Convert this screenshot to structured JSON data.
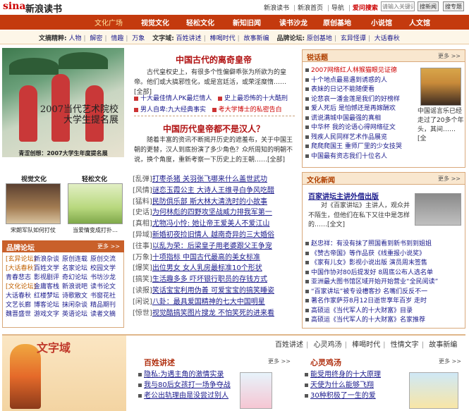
{
  "header": {
    "logo": "sina",
    "site_name": "新浪读书",
    "links": [
      "新浪读书",
      "新浪首页",
      "导航",
      "爱问搜索"
    ],
    "search_placeholder": "请输入关键词",
    "search_btn": "搜新闻",
    "search_btn2": "搜专题"
  },
  "nav": {
    "items": [
      "文化广场",
      "视觉文化",
      "轻松文化",
      "新知旧闻",
      "读书沙龙",
      "原创基地",
      "小说馆",
      "人文馆"
    ]
  },
  "subnav": {
    "groups": [
      {
        "label": "文摘精粹:",
        "links": [
          "人物",
          "解密",
          "情趣",
          "万象"
        ]
      },
      {
        "label": "文字域:",
        "links": [
          "百姓讲述",
          "棒喝时代",
          "故事新编"
        ]
      },
      {
        "label": "品牌论坛:",
        "links": [
          "原创基地",
          "玄异怪谭",
          "大话春秋"
        ]
      }
    ]
  },
  "promo": {
    "text_line1": "2007当代艺术院校",
    "text_line2": "大学生提名展",
    "caption": "青涩创想：2007大学生年度提名展"
  },
  "thumbs": [
    {
      "title": "视觉文化",
      "caption": "宋朗军队如何打仗"
    },
    {
      "title": "轻松文化",
      "caption": "当爱情变成打扑…"
    }
  ],
  "forum": {
    "title": "品牌论坛",
    "more": "更多 >>",
    "rows": [
      [
        "[玄异论坛]",
        "新浪杂谈",
        "原创连载",
        "原创交流"
      ],
      [
        "[大话春秋]",
        "百姓文学",
        "名家论坛",
        "校园文学"
      ],
      [
        "青春悲志",
        "影视剧评",
        "奇幻论坛",
        "书坊沙龙"
      ],
      [
        "[文化论坛]",
        "金庸客栈",
        "新浪说吧",
        "读书论文"
      ],
      [
        "大话春秋",
        "红楼梦坛",
        "诗歌散文",
        "书窗花社"
      ],
      [
        "文艺长廊",
        "博客论坛",
        "抹闲杂谈",
        "精品期刊"
      ],
      [
        "魏晋盛世",
        "游戏文字",
        "英语论坛",
        "读者文摘"
      ]
    ]
  },
  "center": {
    "title1": "中国古代的离奇皇帝",
    "para1": "古代皇权史上，有很多个性偏僻乖张为所欲为的皇帝。他们或大搞邪性化，或是宫廷活，或荣淫糜惰……[全部]",
    "highlights": [
      [
        "十大最佳情人PK最烂情人",
        "史上最恐怖的十大酷刑"
      ],
      [
        "男人自卑:九大经典事实",
        "考大学博士的私密告白"
      ]
    ],
    "title2": "中国历代皇帝都不是汉人？",
    "para2": "随着丰富的资讯不断揭开历史的遮羞布，关于中国王朝的更替，汉人到底扮演了多少角色？众所周知的明朝不说，换个角度，重新考察一下历史上的王朝……[全部]",
    "list": [
      {
        "tag": "[乱弹]",
        "text": "打枣杀猪 关羽张飞哪来什么盖世武功"
      },
      {
        "tag": "[风情]",
        "text": "谜恋玉霞公主 大诗人王维寻白争风吃醋"
      },
      {
        "tag": "[猛料]",
        "text": "民防俱乐部 斯大林大清洗时的小故事"
      },
      {
        "tag": "[史话]",
        "text": "为何林彪的四野攻坚战威力排我军第一"
      },
      {
        "tag": "[真相]",
        "text": "尤物冯小怜: 她让帝王爱美人不爱江山"
      },
      {
        "tag": "[异域]",
        "text": "新婚初夜捡旧情人 越南奇异的三大婚俗"
      },
      {
        "tag": "[往事]",
        "text": "以乱为荣：后梁皇子用老婆跟父王争宠"
      },
      {
        "tag": "[万象]",
        "text": "十项指标 中国古代最高的美女标准"
      },
      {
        "tag": "[爆笑]",
        "text": "出位男女 女人乳房最标准10个形状"
      },
      {
        "tag": "[搞笑]",
        "text": "生活趣多多 吓坏银行职员的存钱方式"
      },
      {
        "tag": "[读报]",
        "text": "笑话宝宝利用伪善 可爱宝宝的搞笑睡姿"
      },
      {
        "tag": "[闲说]",
        "text": "八卦：最具爱国精神的七大中国明星"
      },
      {
        "tag": "[惊世]",
        "text": "视觉酷搞笑图片搜龙 不怕笑死的进来看"
      }
    ]
  },
  "hot": {
    "title": "锐话题",
    "more": "更多 >>",
    "items": [
      {
        "text": "2007网络红人林猴猫眼见证德",
        "red": true
      },
      {
        "text": "十个地点最易遇到诱惑的人",
        "red": false
      },
      {
        "text": "表妹的日记不能随便看",
        "red": false
      },
      {
        "text": "论悲哀一潘金莲是我们的好榜样",
        "red": false
      },
      {
        "text": "爱人死后 是怕憾还是再嫁酬欢",
        "red": false
      },
      {
        "text": "谎说满城中国最强的真相",
        "red": false
      },
      {
        "text": "中华杯 我的论语心得网络征文",
        "red": false
      },
      {
        "text": "残疾人民同样艺术作品展览",
        "red": false
      },
      {
        "text": "爬爬爬国王 重师厂里的少女技哭",
        "red": false
      },
      {
        "text": "中国最有资志我们十位名人",
        "red": false
      }
    ],
    "person_caption": "中国谣言乐已经走过了20多个年头，其间……[全"
  },
  "news": {
    "title": "文化新闻",
    "more": "更多 >>",
    "headline": "百家讲坛主讲外借出版",
    "para": "对《百家讲坛》主讲人，观众并不陌生，但他们在私下又往中是怎样的……[全文]",
    "items": [
      "赵忠祥：有没有抹了照国看到新书到到姐姐",
      "《赞古帝国》等作品获《线重报小说奖》",
      "《家有儿女》影视小说出版 演员周末签售",
      "中国作协对80后提发好 8周底公布人选名单",
      "亚洲最大图书馆区域开始开始营业“全民阅读”",
      "“百家讲坛”被专设槽客抄 名嘴们反反不一",
      "著名作家萨芬8月12日逝世享年百岁 走时",
      "高硕运《当代军人的十大财富》目录",
      "高硕运《当代军人的十大财富》名家推荐"
    ]
  },
  "bottom": {
    "title": "文字域",
    "tabs": [
      "百姓讲述",
      "心灵鸡汤",
      "棒喝时代",
      "性情文字",
      "故事新编"
    ],
    "col1": {
      "title": "百姓讲述",
      "more": "更多 >>",
      "items": [
        "隐私:为遇主角的激情实录",
        "我与80后女孩打一场争夺战",
        "老公出轨理由是没尝过别人"
      ]
    },
    "col2": {
      "title": "心灵鸡汤",
      "more": "更多 >>",
      "items": [
        "能受用终身的十大原理",
        "天使为什么能够飞翔",
        "30种积极了一生的爱"
      ]
    }
  }
}
